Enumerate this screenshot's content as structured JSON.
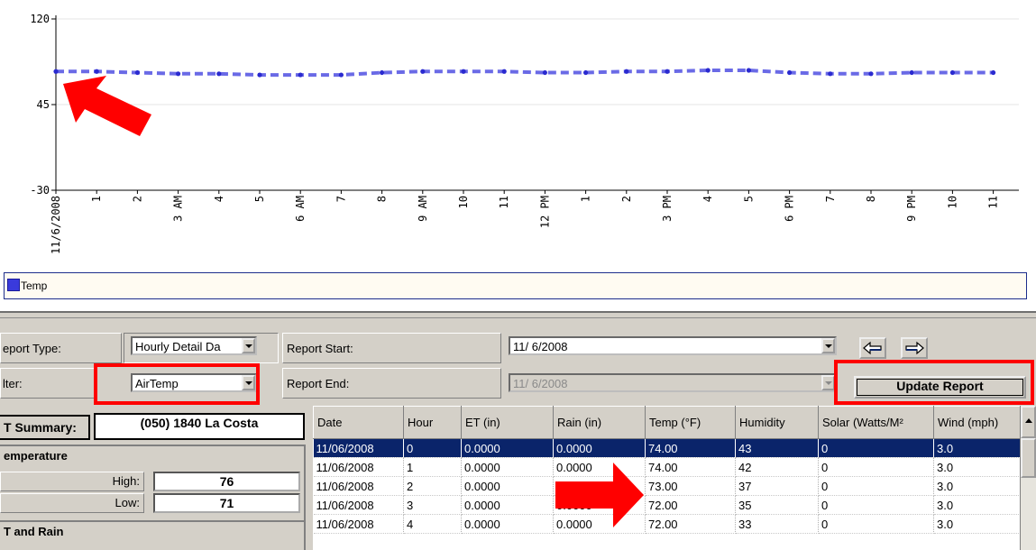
{
  "chart_data": {
    "type": "line",
    "x_tick_labels": [
      "11/6/2008",
      "1",
      "2",
      "3 AM",
      "4",
      "5",
      "6 AM",
      "7",
      "8",
      "9 AM",
      "10",
      "11",
      "12 PM",
      "1",
      "2",
      "3 PM",
      "4",
      "5",
      "6 PM",
      "7",
      "8",
      "9 PM",
      "10",
      "11"
    ],
    "y_ticks": [
      "120",
      "45",
      "-30"
    ],
    "ylim": [
      -30,
      120
    ],
    "grid": true,
    "legend_position": "bottom",
    "series": [
      {
        "name": "Temp",
        "color": "#6a6ae6",
        "style": "dashed",
        "values": [
          74,
          74,
          73,
          72,
          72,
          71,
          71,
          71,
          73,
          74,
          74,
          74,
          73,
          73,
          74,
          74,
          75,
          75,
          73,
          72,
          72,
          73,
          73,
          73
        ]
      }
    ]
  },
  "legend": {
    "label": "Temp",
    "color": "#3a3adc"
  },
  "annotations": {
    "arrow_color": "#ff0000",
    "box_color": "#ff0000"
  },
  "controls": {
    "report_type_label": "eport Type:",
    "report_type_value": "Hourly Detail Da",
    "filter_label": "lter:",
    "filter_value": "AirTemp",
    "report_start_label": "Report Start:",
    "report_start_value": "11/ 6/2008",
    "report_end_label": "Report End:",
    "report_end_value": "11/ 6/2008",
    "update_button": "Update Report",
    "prev_icon": "left-arrow-icon",
    "next_icon": "right-arrow-icon"
  },
  "summary": {
    "tab_label": "T Summary:",
    "station": "(050) 1840 La Costa",
    "temperature_heading": "emperature",
    "high_label": "High:",
    "high_value": "76",
    "low_label": "Low:",
    "low_value": "71",
    "et_rain_heading": "T and Rain"
  },
  "grid": {
    "headers": [
      "Date",
      "Hour",
      "ET (in)",
      "Rain (in)",
      "Temp (°F)",
      "Humidity",
      "Solar (Watts/M²",
      "Wind (mph)"
    ],
    "rows": [
      [
        "11/06/2008",
        "0",
        "0.0000",
        "0.0000",
        "74.00",
        "43",
        "0",
        "3.0"
      ],
      [
        "11/06/2008",
        "1",
        "0.0000",
        "0.0000",
        "74.00",
        "42",
        "0",
        "3.0"
      ],
      [
        "11/06/2008",
        "2",
        "0.0000",
        "",
        "73.00",
        "37",
        "0",
        "3.0"
      ],
      [
        "11/06/2008",
        "3",
        "0.0000",
        "0.0000",
        "72.00",
        "35",
        "0",
        "3.0"
      ],
      [
        "11/06/2008",
        "4",
        "0.0000",
        "0.0000",
        "72.00",
        "33",
        "0",
        "3.0"
      ]
    ],
    "selected_row": 0
  }
}
